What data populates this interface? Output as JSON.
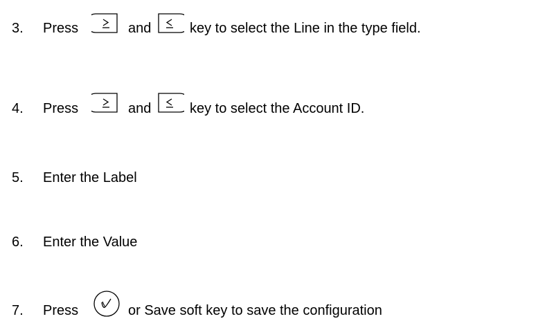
{
  "steps": [
    {
      "number": "3.",
      "parts": [
        "Press",
        "and",
        "key to select the Line in the type field."
      ],
      "keys": [
        "right-arrow-key-icon",
        "left-arrow-key-icon"
      ]
    },
    {
      "number": "4.",
      "parts": [
        "Press",
        "and",
        "key to select the Account ID."
      ],
      "keys": [
        "right-arrow-key-icon",
        "left-arrow-key-icon"
      ]
    },
    {
      "number": "5.",
      "parts": [
        "Enter the Label"
      ]
    },
    {
      "number": "6.",
      "parts": [
        "Enter the Value"
      ]
    },
    {
      "number": "7.",
      "parts": [
        "Press",
        "or Save soft key to save the configuration"
      ],
      "keys": [
        "ok-check-key-icon"
      ]
    }
  ]
}
